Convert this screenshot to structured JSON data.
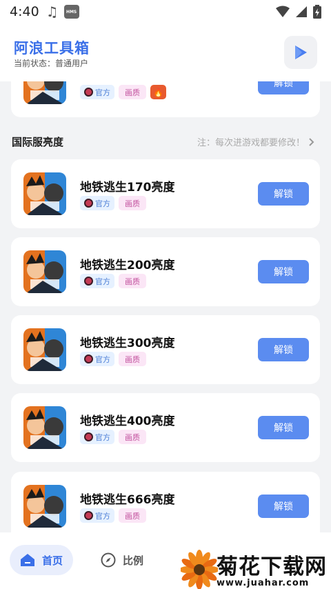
{
  "status_bar": {
    "time": "4:40",
    "badge": "HMS"
  },
  "header": {
    "title": "阿浪工具箱",
    "status": "当前状态：普通用户"
  },
  "section": {
    "title": "国际服亮度",
    "note": "注：每次进游戏都要修改！"
  },
  "top_card": {
    "tags": [
      "官方",
      "画质"
    ],
    "unlock_label": "解锁"
  },
  "cards": [
    {
      "name": "地铁逃生170亮度",
      "tags": [
        "官方",
        "画质"
      ],
      "unlock_label": "解锁"
    },
    {
      "name": "地铁逃生200亮度",
      "tags": [
        "官方",
        "画质"
      ],
      "unlock_label": "解锁"
    },
    {
      "name": "地铁逃生300亮度",
      "tags": [
        "官方",
        "画质"
      ],
      "unlock_label": "解锁"
    },
    {
      "name": "地铁逃生400亮度",
      "tags": [
        "官方",
        "画质"
      ],
      "unlock_label": "解锁"
    },
    {
      "name": "地铁逃生666亮度",
      "tags": [
        "官方",
        "画质"
      ],
      "unlock_label": "解锁"
    }
  ],
  "bottom_nav": {
    "home_label": "首页",
    "ratio_label": "比例"
  },
  "watermark": {
    "text": "菊花下载网",
    "url": "www.juahar.com"
  },
  "colors": {
    "accent": "#3a6fe8",
    "button": "#5b8cf0",
    "official_tag_bg": "#e6f1ff",
    "quality_tag_bg": "#fbe6f6"
  }
}
